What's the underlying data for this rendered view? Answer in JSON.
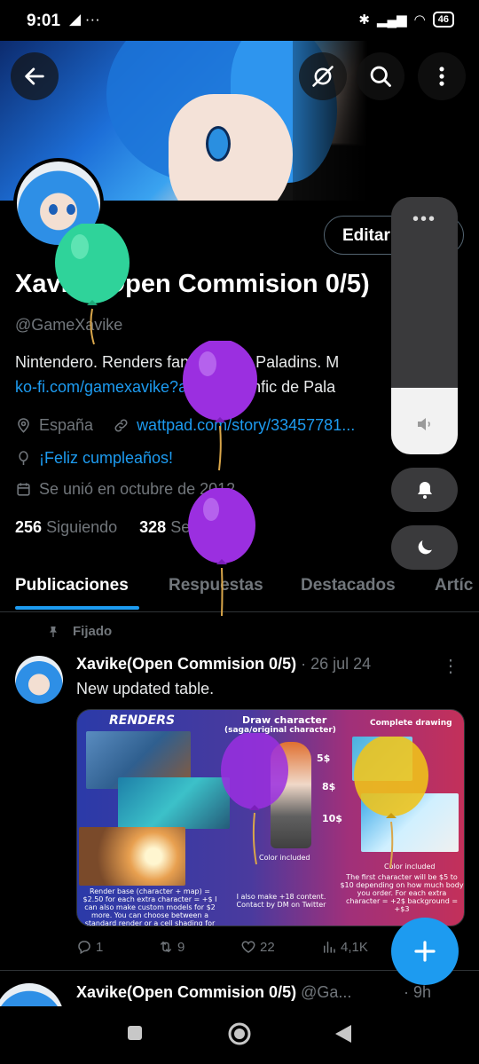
{
  "status_bar": {
    "time": "9:01",
    "left_icons": "◢ ···",
    "battery": "46"
  },
  "profile": {
    "edit_label": "Editar",
    "display_name": "Xavike(Open Commision 0/5)",
    "handle": "@GameXavike",
    "bio_line1": "Nintendero. Renders fanmade de Paladins. M",
    "bio_link": "ko-fi.com/gamexavike?act...",
    "bio_line2_rest": " Mi fanfic de Pala",
    "location": "España",
    "website": "wattpad.com/story/33457781...",
    "birthday": "¡Feliz cumpleaños!",
    "joined": "Se unió en octubre de 2012",
    "following_count": "256",
    "following_label": "Siguiendo",
    "followers_count": "328",
    "followers_label": "Seguidores"
  },
  "tabs": [
    "Publicaciones",
    "Respuestas",
    "Destacados",
    "Artíc"
  ],
  "pinned_label": "Fijado",
  "tweets": [
    {
      "name": "Xavike(Open Commision 0/5)",
      "meta": " · 26 jul 24",
      "text": "New updated table.",
      "replies": "1",
      "retweets": "9",
      "likes": "22",
      "views": "4,1K"
    },
    {
      "name": "Xavike(Open Commision 0/5)",
      "meta": " @Ga...",
      "time": "· 9h"
    }
  ],
  "media": {
    "renders_title": "RENDERS",
    "draw_title": "Draw character",
    "draw_sub": "(saga/original character)",
    "complete_title": "Complete drawing",
    "prices": [
      "5$",
      "8$",
      "10$"
    ],
    "color_included_1": "Color included",
    "color_included_2": "Color included",
    "renders_note": "Render base (character + map) = $2.50 for each extra character = +$ I can also make custom models for $2 more. You can choose between a standard render or a cell shading for the same price.",
    "draw_note": "I also make +18 content. Contact by DM on Twitter",
    "complete_note": "The first character will be $5 to $10 depending on how much body you order. For each extra character = +2$ background = +$3"
  },
  "volume": {
    "level": 0.26
  },
  "colors": {
    "accent": "#1d9bf0",
    "muted": "#71767b",
    "balloon_green": "#2fd39a",
    "balloon_purple": "#9b2fe0",
    "balloon_yellow": "#f0c419"
  }
}
